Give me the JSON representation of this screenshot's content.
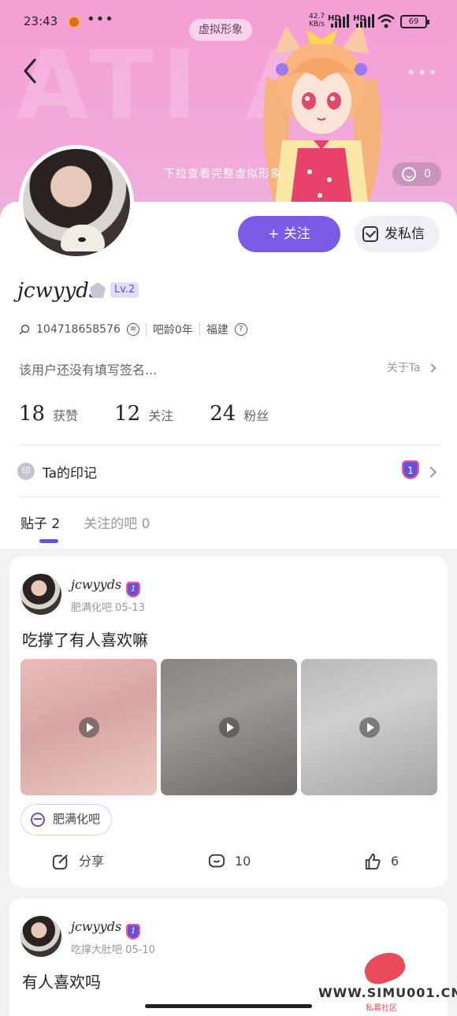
{
  "status_bar": {
    "time": "23:43",
    "more": "•••",
    "net_speed": "42.7",
    "net_unit": "KB/s",
    "hd1": "HD",
    "hd2": "HD",
    "battery": "69"
  },
  "header": {
    "virtual_tag": "虚拟形象",
    "pulldown_hint": "下拉查看完整虚拟形象",
    "like_count": "0",
    "bg_letters": "ATI A"
  },
  "profile": {
    "follow_label": "+ 关注",
    "message_label": "发私信",
    "username": "jcwyyds",
    "level": "Lv.2",
    "user_id": "104718658576",
    "bar_age": "吧龄0年",
    "location": "福建",
    "signature": "该用户还没有填写签名...",
    "about_label": "关于Ta",
    "stats": [
      {
        "value": "18",
        "label": "获赞"
      },
      {
        "value": "12",
        "label": "关注"
      },
      {
        "value": "24",
        "label": "粉丝"
      }
    ],
    "imprint_icon": "印",
    "imprint_label": "Ta的印记",
    "badge_num": "1"
  },
  "tabs": [
    {
      "label": "贴子 2"
    },
    {
      "label": "关注的吧 0"
    }
  ],
  "posts": [
    {
      "username": "jcwyyds",
      "badge": "1",
      "forum_date": "肥满化吧  05-13",
      "title": "吃撑了有人喜欢嘛",
      "forum_chip": "肥满化吧",
      "share_label": "分享",
      "comments": "10",
      "likes": "6"
    },
    {
      "username": "jcwyyds",
      "badge": "1",
      "forum_date": "吃撑大肚吧  05-10",
      "title": "有人喜欢吗"
    }
  ],
  "watermark": {
    "url": "WWW.SIMU001.CN",
    "sub": "私募社区"
  },
  "colors": {
    "accent": "#7b5ae8",
    "banner_pink": "#f59ed6",
    "badge_purple": "#6a4fd8"
  }
}
